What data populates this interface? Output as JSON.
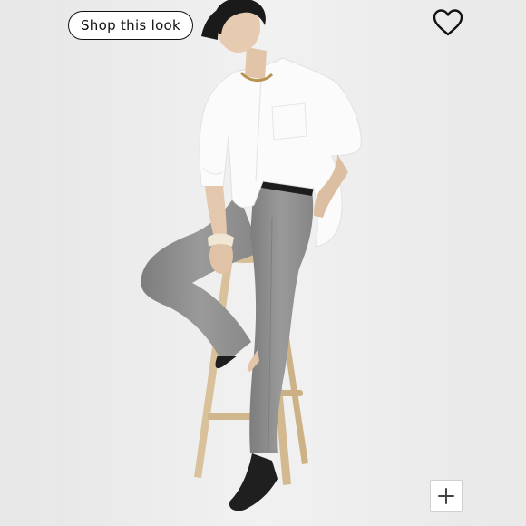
{
  "overlay": {
    "shop_button_label": "Shop this look"
  },
  "icons": {
    "favorite": "heart-outline-icon",
    "zoom": "plus-icon"
  },
  "colors": {
    "background": "#efefef",
    "button_border": "#111111",
    "button_text": "#111111",
    "shirt": "#fafafa",
    "trousers": "#8c8c8c",
    "stool_wood": "#dcc39a"
  }
}
